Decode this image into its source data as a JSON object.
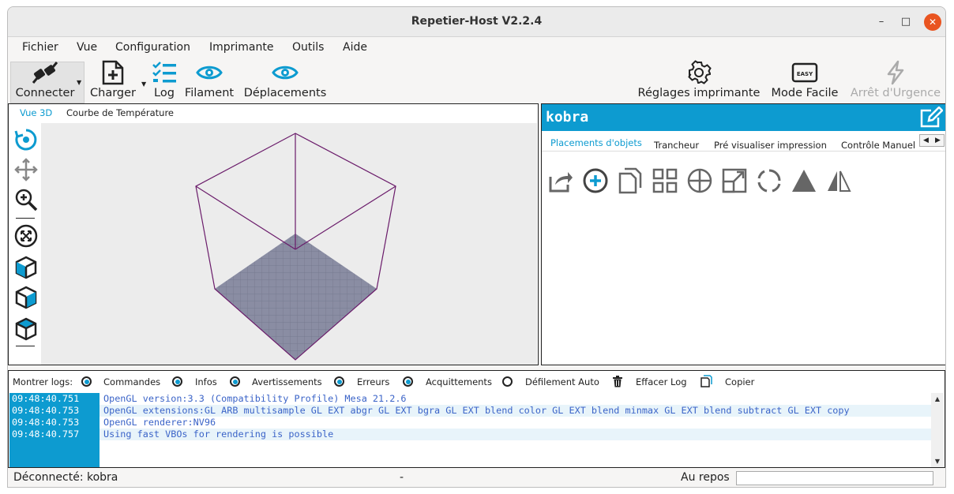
{
  "window": {
    "title": "Repetier-Host V2.2.4",
    "controls": {
      "minimize": "–",
      "maximize": "□",
      "close": "✕"
    }
  },
  "menu": [
    "Fichier",
    "Vue",
    "Configuration",
    "Imprimante",
    "Outils",
    "Aide"
  ],
  "toolbar": {
    "connect": "Connecter",
    "load": "Charger",
    "log": "Log",
    "filament": "Filament",
    "moves": "Déplacements",
    "printer_settings": "Réglages imprimante",
    "easy_mode": "Mode Facile",
    "easy_badge": "EASY",
    "emergency_stop": "Arrêt d'Urgence"
  },
  "view_tabs": {
    "active": "Vue 3D",
    "other": "Courbe de Température"
  },
  "printer": {
    "name": "kobra"
  },
  "right_tabs": [
    "Placements d'objets",
    "Trancheur",
    "Pré visualiser impression",
    "Contrôle Manuel"
  ],
  "log_options": {
    "label": "Montrer logs:",
    "commands": "Commandes",
    "infos": "Infos",
    "warnings": "Avertissements",
    "errors": "Erreurs",
    "acks": "Acquittements",
    "autoscroll": "Défilement Auto",
    "clear": "Effacer Log",
    "copy": "Copier"
  },
  "logs": [
    {
      "time": "09:48:40.751",
      "text": "OpenGL version:3.3 (Compatibility Profile) Mesa 21.2.6"
    },
    {
      "time": "09:48:40.753",
      "text": "OpenGL extensions:GL ARB multisample GL EXT abgr GL EXT bgra GL EXT blend color GL EXT blend minmax GL EXT blend subtract GL EXT copy"
    },
    {
      "time": "09:48:40.753",
      "text": "OpenGL renderer:NV96"
    },
    {
      "time": "09:48:40.757",
      "text": "Using fast VBOs for rendering is possible"
    }
  ],
  "status": {
    "connection": "Déconnecté: kobra",
    "middle": "-",
    "state": "Au repos"
  },
  "colors": {
    "accent": "#0d9bd0",
    "bed": "#7e8299",
    "box": "#6a1b6a"
  }
}
